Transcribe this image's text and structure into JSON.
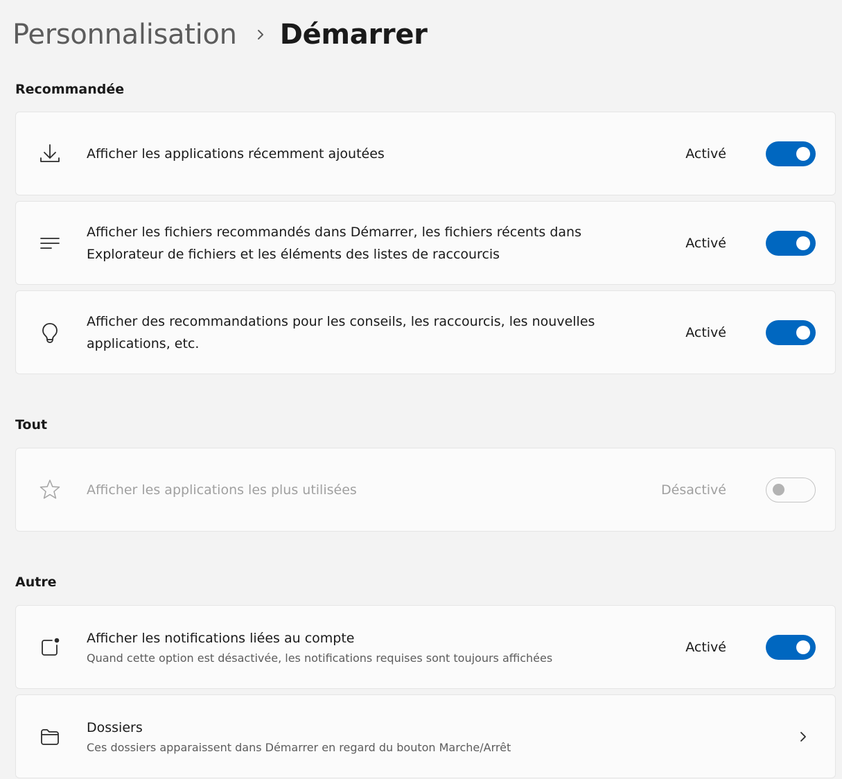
{
  "breadcrumb": {
    "parent": "Personnalisation",
    "current": "Démarrer"
  },
  "sections": {
    "recommended": {
      "title": "Recommandée"
    },
    "all": {
      "title": "Tout"
    },
    "other": {
      "title": "Autre"
    }
  },
  "settings": {
    "recent_apps": {
      "label": "Afficher les applications récemment ajoutées",
      "state": "Activé",
      "enabled": true,
      "icon": "download-icon"
    },
    "recommended_files": {
      "label": "Afficher les fichiers recommandés dans Démarrer, les fichiers récents dans Explorateur de fichiers et les éléments des listes de raccourcis",
      "state": "Activé",
      "enabled": true,
      "icon": "lines-icon"
    },
    "tips": {
      "label": "Afficher des recommandations pour les conseils, les raccourcis, les nouvelles applications, etc.",
      "state": "Activé",
      "enabled": true,
      "icon": "lightbulb-icon"
    },
    "most_used": {
      "label": "Afficher les applications les plus utilisées",
      "state": "Désactivé",
      "enabled": false,
      "disabled": true,
      "icon": "star-icon"
    },
    "account_notifications": {
      "label": "Afficher les notifications liées au compte",
      "description": "Quand cette option est désactivée, les notifications requises sont toujours affichées",
      "state": "Activé",
      "enabled": true,
      "icon": "notification-badge-icon"
    },
    "folders": {
      "label": "Dossiers",
      "description": "Ces dossiers apparaissent dans Démarrer en regard du bouton Marche/Arrêt",
      "icon": "folder-icon"
    }
  },
  "colors": {
    "accent": "#0067c0",
    "background": "#f3f3f3",
    "card": "#fbfbfb"
  }
}
